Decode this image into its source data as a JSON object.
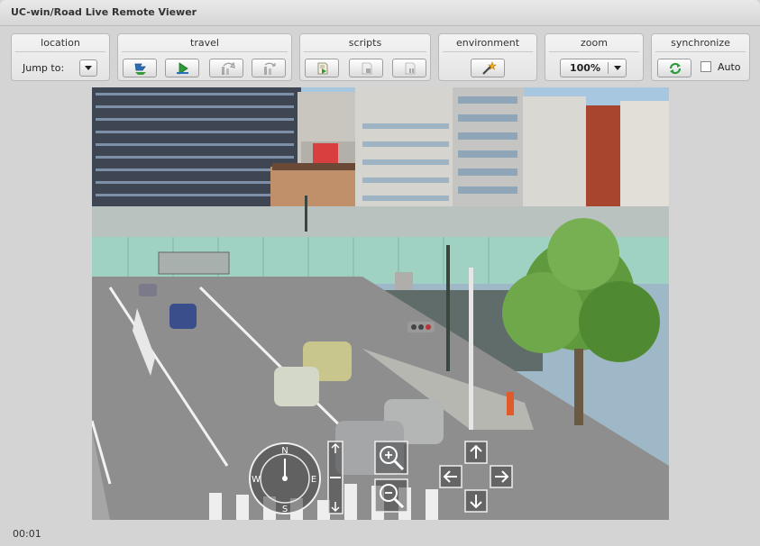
{
  "window": {
    "title": "UC-win/Road Live Remote Viewer"
  },
  "toolbar": {
    "location": {
      "title": "location",
      "jump_label": "Jump to:"
    },
    "travel": {
      "title": "travel"
    },
    "scripts": {
      "title": "scripts"
    },
    "environment": {
      "title": "environment"
    },
    "zoom": {
      "title": "zoom",
      "value": "100%"
    },
    "synchronize": {
      "title": "synchronize",
      "auto_label": "Auto",
      "auto_checked": false
    }
  },
  "viewport": {
    "navigation": {
      "compass_letters": [
        "N",
        "E",
        "S",
        "W"
      ],
      "zoom_in": "+",
      "zoom_out": "−"
    }
  },
  "status": {
    "time": "00:01"
  },
  "colors": {
    "sky": "#a7c6e0",
    "road": "#8e8e8e",
    "overpass": "#9fd2c2",
    "tree": "#5f9a3e",
    "icon_blue": "#2b6fb6",
    "icon_green": "#2e9b3a"
  },
  "icons": {
    "travel": [
      "walk-icon",
      "play-icon",
      "step-forward-icon",
      "step-back-icon"
    ],
    "scripts": [
      "script-play-icon",
      "script-stop-icon",
      "script-pause-icon"
    ],
    "environment": [
      "magic-wand-icon"
    ],
    "synchronize": [
      "refresh-icon"
    ]
  }
}
